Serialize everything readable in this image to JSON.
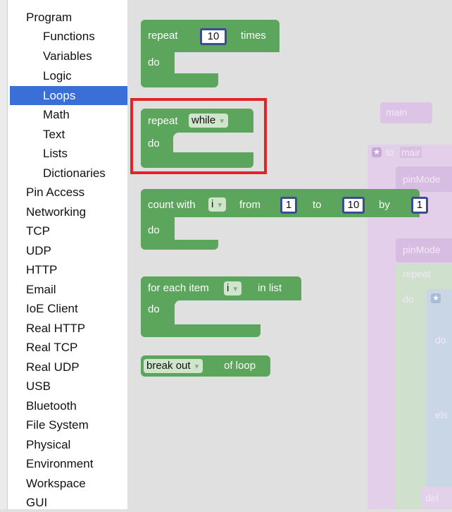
{
  "toolbox": {
    "categories": [
      {
        "label": "Program",
        "indent": 0,
        "selected": false
      },
      {
        "label": "Functions",
        "indent": 1,
        "selected": false
      },
      {
        "label": "Variables",
        "indent": 1,
        "selected": false
      },
      {
        "label": "Logic",
        "indent": 1,
        "selected": false
      },
      {
        "label": "Loops",
        "indent": 1,
        "selected": true
      },
      {
        "label": "Math",
        "indent": 1,
        "selected": false
      },
      {
        "label": "Text",
        "indent": 1,
        "selected": false
      },
      {
        "label": "Lists",
        "indent": 1,
        "selected": false
      },
      {
        "label": "Dictionaries",
        "indent": 1,
        "selected": false
      },
      {
        "label": "Pin Access",
        "indent": 0,
        "selected": false
      },
      {
        "label": "Networking",
        "indent": 0,
        "selected": false
      },
      {
        "label": "TCP",
        "indent": 0,
        "selected": false
      },
      {
        "label": "UDP",
        "indent": 0,
        "selected": false
      },
      {
        "label": "HTTP",
        "indent": 0,
        "selected": false
      },
      {
        "label": "Email",
        "indent": 0,
        "selected": false
      },
      {
        "label": "IoE Client",
        "indent": 0,
        "selected": false
      },
      {
        "label": "Real HTTP",
        "indent": 0,
        "selected": false
      },
      {
        "label": "Real TCP",
        "indent": 0,
        "selected": false
      },
      {
        "label": "Real UDP",
        "indent": 0,
        "selected": false
      },
      {
        "label": "USB",
        "indent": 0,
        "selected": false
      },
      {
        "label": "Bluetooth",
        "indent": 0,
        "selected": false
      },
      {
        "label": "File System",
        "indent": 0,
        "selected": false
      },
      {
        "label": "Physical",
        "indent": 0,
        "selected": false
      },
      {
        "label": "Environment",
        "indent": 0,
        "selected": false
      },
      {
        "label": "Workspace",
        "indent": 0,
        "selected": false
      },
      {
        "label": "GUI",
        "indent": 0,
        "selected": false
      }
    ]
  },
  "blocks": {
    "repeat_times": {
      "repeat": "repeat",
      "count": "10",
      "times": "times",
      "do": "do"
    },
    "repeat_while": {
      "repeat": "repeat",
      "mode": "while",
      "do": "do"
    },
    "count_with": {
      "label": "count with",
      "var": "i",
      "from": "from",
      "from_val": "1",
      "to": "to",
      "to_val": "10",
      "by": "by",
      "by_val": "1",
      "do": "do"
    },
    "for_each": {
      "label": "for each item",
      "var": "i",
      "in_list": "in list",
      "do": "do"
    },
    "break_out": {
      "mode": "break out",
      "of_loop": "of loop"
    }
  },
  "background_program": {
    "main_label": "main",
    "to_label": "to",
    "to_name": "mair",
    "pinmode1": "pinMode",
    "pinmode2": "pinMode",
    "repeat_label": "repeat",
    "do_label": "do",
    "inner_do": "do",
    "else_label": "els",
    "del_label": "del"
  },
  "colors": {
    "loop_block": "#5ca55c",
    "highlight_box": "#e0242a",
    "selected_category": "#3a6fd8"
  }
}
